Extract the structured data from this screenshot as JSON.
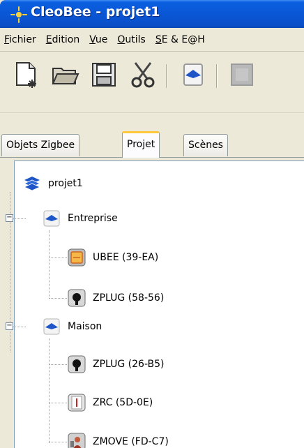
{
  "window": {
    "title": "CleoBee - projet1"
  },
  "menubar": {
    "items": [
      {
        "label": "Fichier",
        "mnemonic": "F"
      },
      {
        "label": "Edition",
        "mnemonic": "E"
      },
      {
        "label": "Vue",
        "mnemonic": "V"
      },
      {
        "label": "Outils",
        "mnemonic": "O"
      },
      {
        "label": "SE & E@H",
        "mnemonic": "S"
      }
    ]
  },
  "toolbar": {
    "buttons": [
      {
        "icon": "new-document-icon"
      },
      {
        "icon": "open-folder-icon"
      },
      {
        "icon": "save-disk-icon"
      },
      {
        "icon": "cut-scissors-icon"
      },
      {
        "icon": "project-layer-icon"
      },
      {
        "icon": "disabled-device-icon"
      }
    ]
  },
  "tabs": [
    {
      "label": "Objets Zigbee",
      "active": false
    },
    {
      "label": "Projet",
      "active": true
    },
    {
      "label": "Scènes",
      "active": false
    }
  ],
  "tree": {
    "root": {
      "label": "projet1"
    },
    "groups": [
      {
        "label": "Entreprise",
        "expanded": true,
        "children": [
          {
            "label": "UBEE (39-EA)",
            "icon": "ubee-icon"
          },
          {
            "label": "ZPLUG (58-56)",
            "icon": "zplug-icon"
          }
        ]
      },
      {
        "label": "Maison",
        "expanded": true,
        "children": [
          {
            "label": "ZPLUG (26-B5)",
            "icon": "zplug-icon"
          },
          {
            "label": "ZRC (5D-0E)",
            "icon": "zrc-icon"
          },
          {
            "label": "ZMOVE (FD-C7)",
            "icon": "zmove-icon"
          }
        ]
      }
    ]
  },
  "colors": {
    "titlebar": "#0a57d6",
    "active_tab_accent": "#ffc73c",
    "chrome_background": "#ece9d8",
    "tree_background": "#ffffff"
  }
}
